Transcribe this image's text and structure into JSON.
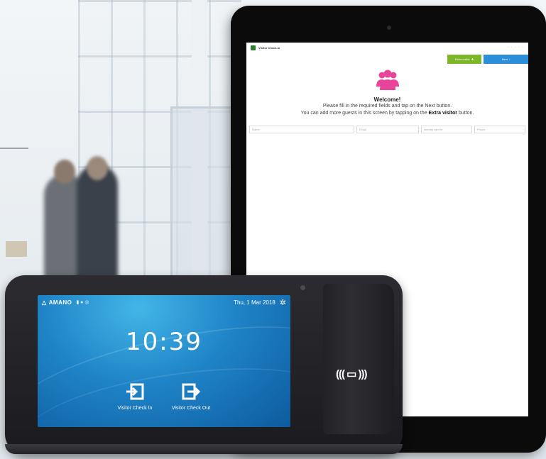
{
  "tablet": {
    "app_title": "Visitor Check-in",
    "extra_visitor_label": "Extra visitor",
    "extra_visitor_icon": "plus-icon",
    "next_label": "Next",
    "next_icon": "chevron-right-icon",
    "welcome_title": "Welcome!",
    "instruction_line1": "Please fill in the required fields and tap on the Next button.",
    "instruction_line2_prefix": "You can add more guests in this screen by tapping on the ",
    "instruction_line2_bold": "Extra visitor",
    "instruction_line2_suffix": " button.",
    "fields": {
      "name_placeholder": "Name",
      "email_placeholder": "Email",
      "identity_placeholder": "Identity card nr.",
      "phone_placeholder": "Phone"
    },
    "colors": {
      "extra_visitor": "#7cb72a",
      "next": "#2b8ed9",
      "group_icon": "#e8449a"
    }
  },
  "terminal": {
    "brand": "AMANO",
    "date": "Thu, 1 Mar 2018",
    "time": "10:39",
    "check_in_label": "Visitor Check In",
    "check_out_label": "Visitor Check Out",
    "reader_symbol": "((( ▭ )))",
    "colors": {
      "screen": "#1f84c7"
    }
  }
}
